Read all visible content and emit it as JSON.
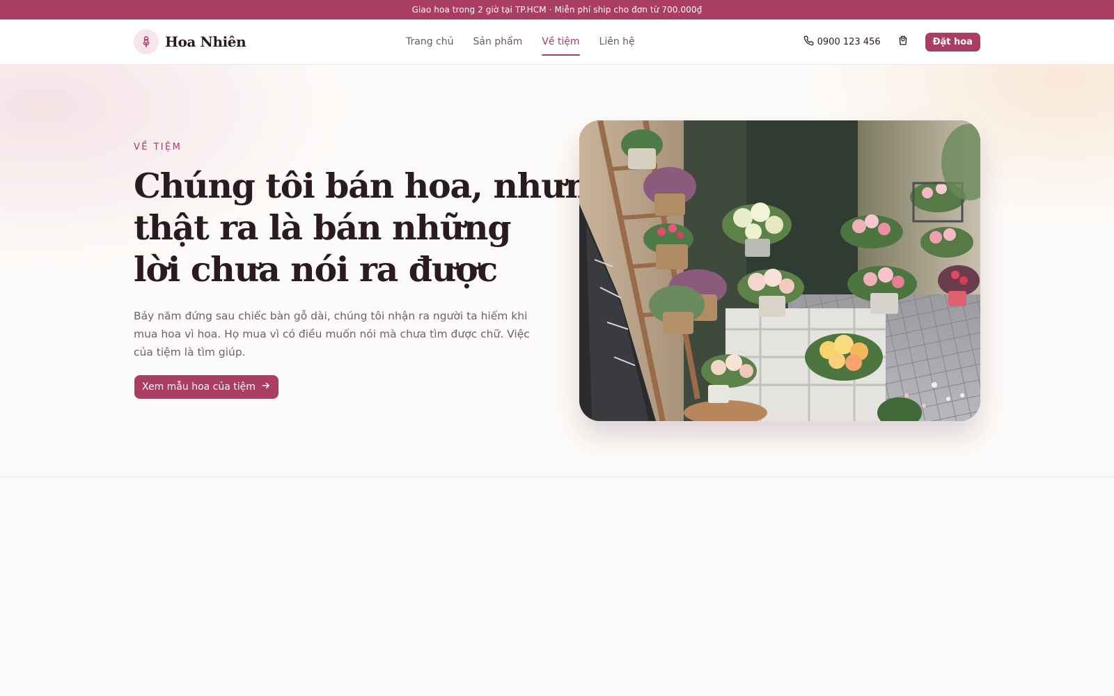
{
  "announcement": "Giao hoa trong 2 giờ tại TP.HCM · Miễn phí ship cho đơn từ 700.000₫",
  "brand": {
    "name": "Hoa Nhiên",
    "logo_icon": "flower-icon"
  },
  "nav": {
    "links": [
      {
        "label": "Trang chủ",
        "active": false
      },
      {
        "label": "Sản phẩm",
        "active": false
      },
      {
        "label": "Về tiệm",
        "active": true
      },
      {
        "label": "Liên hệ",
        "active": false
      }
    ],
    "phone": "0900 123 456",
    "phone_icon": "phone-icon",
    "cart_icon": "shopping-bag-icon",
    "order_button": "Đặt hoa"
  },
  "hero": {
    "eyebrow": "VỀ TIỆM",
    "headline_lines": [
      "Chúng tôi bán hoa, nhưng",
      "thật ra là bán những",
      "lời chưa nói ra được"
    ],
    "lead": "Bảy năm đứng sau chiếc bàn gỗ dài, chúng tôi nhận ra người ta hiếm khi mua hoa vì hoa. Họ mua vì có điều muốn nói mà chưa tìm được chữ. Việc của tiệm là tìm giúp.",
    "cta_label": "Xem mẫu hoa của tiệm",
    "cta_icon": "arrow-right-icon"
  },
  "colors": {
    "accent": "#a93d62",
    "text": "#2a1c1e",
    "muted": "#6f6064",
    "background": "#fdfbf9"
  }
}
